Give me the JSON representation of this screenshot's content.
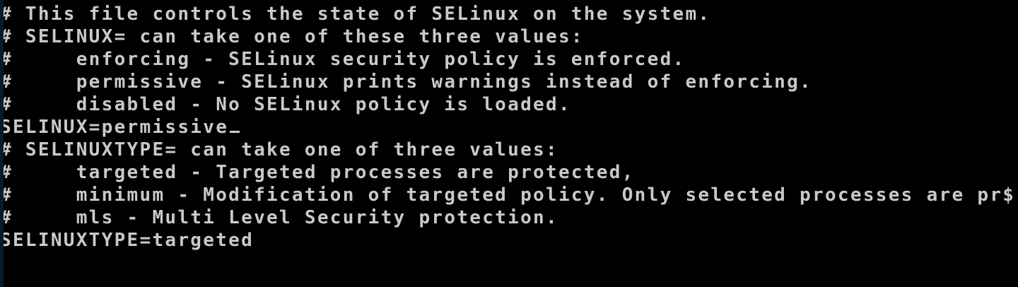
{
  "terminal": {
    "lines": [
      "# This file controls the state of SELinux on the system.",
      "# SELINUX= can take one of these three values:",
      "#     enforcing - SELinux security policy is enforced.",
      "#     permissive - SELinux prints warnings instead of enforcing.",
      "#     disabled - No SELinux policy is loaded.",
      "SELINUX=permissive",
      "# SELINUXTYPE= can take one of three values:",
      "#     targeted - Targeted processes are protected,",
      "#     minimum - Modification of targeted policy. Only selected processes are pr$",
      "#     mls - Multi Level Security protection.",
      "SELINUXTYPE=targeted"
    ],
    "colors": {
      "background": "#000000",
      "foreground": "#c9c9c9"
    }
  }
}
